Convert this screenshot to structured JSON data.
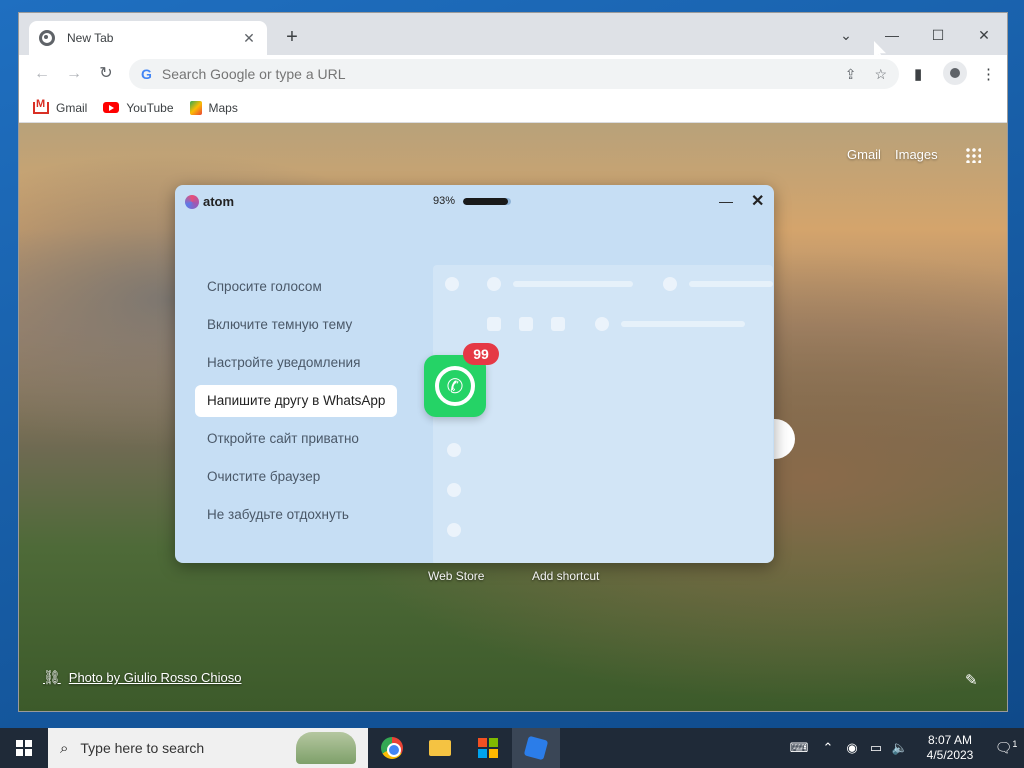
{
  "browser": {
    "tab_title": "New Tab",
    "tab_close": "✕",
    "new_tab": "+",
    "controls": {
      "dropdown": "⌄",
      "minimize": "—",
      "maximize": "☐",
      "close": "✕"
    },
    "omnibox_placeholder": "Search Google or type a URL",
    "bookmarks": [
      {
        "label": "Gmail",
        "icon": "gmail-icon"
      },
      {
        "label": "YouTube",
        "icon": "youtube-icon"
      },
      {
        "label": "Maps",
        "icon": "maps-icon"
      }
    ]
  },
  "newtab": {
    "gmail_link": "Gmail",
    "images_link": "Images",
    "shortcut_web_store": "Web Store",
    "shortcut_add": "Add shortcut",
    "photo_credit": "Photo by Giulio Rosso Chioso"
  },
  "popup": {
    "brand": "atom",
    "progress_text": "93%",
    "progress_value": 0.93,
    "min_icon": "—",
    "close_icon": "✕",
    "menu_items": [
      "Спросите голосом",
      "Включите темную тему",
      "Настройте уведомления",
      "Напишите другу в WhatsApp",
      "Откройте сайт приватно",
      "Очистите браузер",
      "Не забудьте отдохнуть"
    ],
    "active_index": 3,
    "whatsapp_badge": "99"
  },
  "taskbar": {
    "search_placeholder": "Type here to search",
    "time": "8:07 AM",
    "date": "4/5/2023",
    "notification_count": "1"
  },
  "colors": {
    "popup_bg": "#c6def4",
    "whatsapp_green": "#25d366",
    "badge_red": "#e53945",
    "taskbar_bg": "#1f2a38"
  }
}
